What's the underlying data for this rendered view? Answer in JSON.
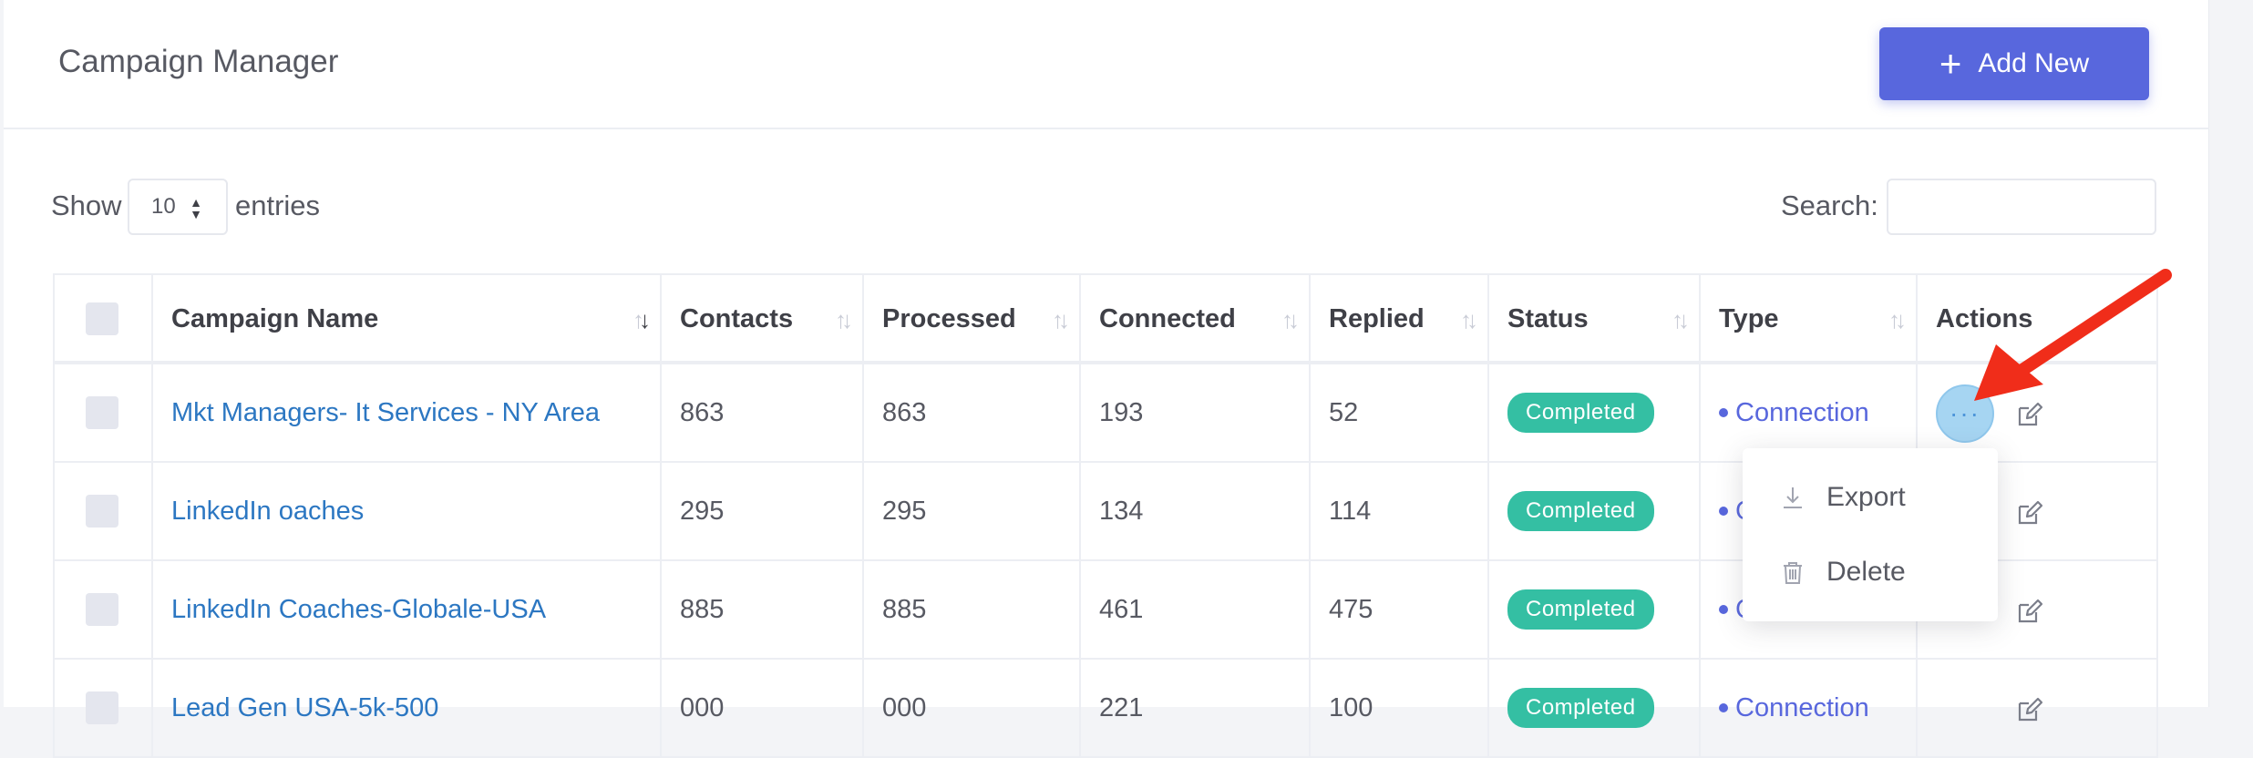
{
  "header": {
    "title": "Campaign Manager",
    "add_button": "Add New"
  },
  "controls": {
    "show_label": "Show",
    "page_length": "10",
    "entries_label": "entries",
    "search_label": "Search:",
    "search_value": ""
  },
  "table": {
    "columns": [
      "Campaign Name",
      "Contacts",
      "Processed",
      "Connected",
      "Replied",
      "Status",
      "Type",
      "Actions"
    ],
    "rows": [
      {
        "name": "Mkt Managers- It Services - NY Area",
        "contacts": "863",
        "processed": "863",
        "connected": "193",
        "replied": "52",
        "status": "Completed",
        "type": "Connection"
      },
      {
        "name": "LinkedIn oaches",
        "contacts": "295",
        "processed": "295",
        "connected": "134",
        "replied": "114",
        "status": "Completed",
        "type": "C"
      },
      {
        "name": "LinkedIn Coaches-Globale-USA",
        "contacts": "885",
        "processed": "885",
        "connected": "461",
        "replied": "475",
        "status": "Completed",
        "type": "C"
      },
      {
        "name": "Lead Gen USA-5k-500",
        "contacts": "000",
        "processed": "000",
        "connected": "221",
        "replied": "100",
        "status": "Completed",
        "type": "Connection"
      }
    ]
  },
  "dropdown_menu": {
    "export": "Export",
    "delete": "Delete"
  },
  "colors": {
    "accent": "#5867dd",
    "success": "#34bfa3",
    "link": "#2c77c2",
    "annotation_arrow": "#f02d1a"
  },
  "icons": [
    "plus-icon",
    "sort-icon",
    "more-horizontal-icon",
    "edit-icon",
    "download-icon",
    "trash-icon",
    "annotation-arrow"
  ]
}
